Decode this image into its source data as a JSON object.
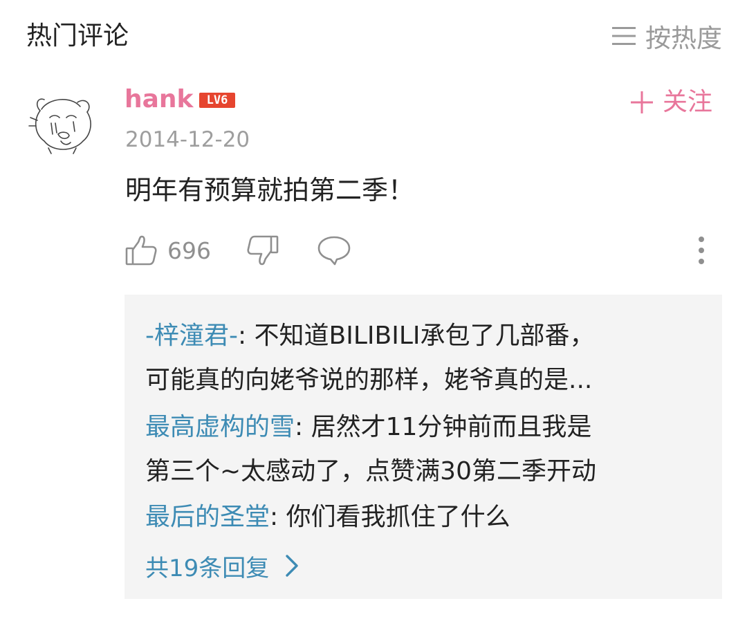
{
  "header": {
    "title": "热门评论",
    "sort_label": "按热度"
  },
  "comment": {
    "username": "hank",
    "level_badge": "LV6",
    "follow_label": "关注",
    "date": "2014-12-20",
    "text": "明年有预算就拍第二季！",
    "like_count": "696",
    "icons": [
      "avatar",
      "menu-icon",
      "plus-icon",
      "thumbs-up-icon",
      "thumbs-down-icon",
      "reply-bubble-icon",
      "more-vertical-icon",
      "chevron-right-icon"
    ],
    "colors": {
      "username": "#e8769b",
      "level_badge": "#e6452f",
      "reply_nick": "#3d8bb4"
    }
  },
  "replies": {
    "lines": [
      {
        "nick": "-梓潼君-",
        "text": ": 不知道BILIBILI承包了几部番，"
      },
      {
        "nick": "",
        "text": "可能真的向姥爷说的那样，姥爷真的是..."
      },
      {
        "nick": "最高虚构的雪",
        "text": ": 居然才11分钟前而且我是"
      },
      {
        "nick": "",
        "text": "第三个~太感动了，点赞满30第二季开动"
      },
      {
        "nick": "最后的圣堂",
        "text": ": 你们看我抓住了什么"
      }
    ],
    "more_label": "共19条回复"
  }
}
